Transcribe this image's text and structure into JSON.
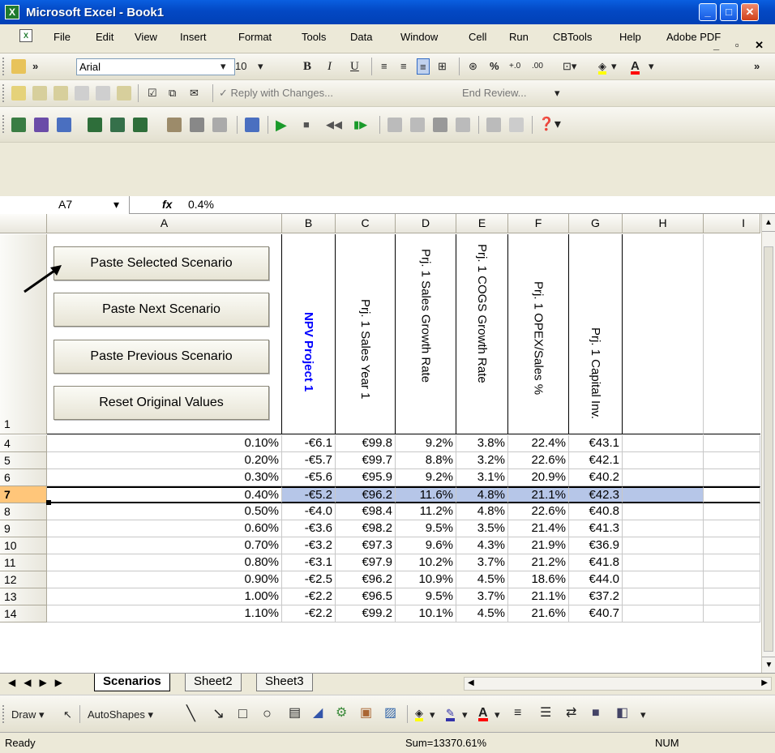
{
  "window": {
    "title": "Microsoft Excel - Book1",
    "app_icon": "excel-icon"
  },
  "menu": [
    "File",
    "Edit",
    "View",
    "Insert",
    "Format",
    "Tools",
    "Data",
    "Window",
    "Cell",
    "Run",
    "CBTools",
    "Help",
    "Adobe PDF"
  ],
  "toolbar": {
    "font": "Arial",
    "size": "10",
    "bold": "B",
    "italic": "I",
    "underline": "U",
    "percent": "%",
    "reply": "Reply with Changes...",
    "end_review": "End Review..."
  },
  "formula_bar": {
    "cell_ref": "A7",
    "fx": "fx",
    "value": "0.4%"
  },
  "columns": [
    "A",
    "B",
    "C",
    "D",
    "E",
    "F",
    "G",
    "H",
    "I"
  ],
  "buttons": [
    "Paste Selected Scenario",
    "Paste Next Scenario",
    "Paste Previous Scenario",
    "Reset Original Values"
  ],
  "headers": {
    "B": "NPV Project 1",
    "C": "Prj. 1 Sales Year 1",
    "D": "Prj. 1 Sales Growth Rate",
    "E": "Prj. 1 COGS Growth Rate",
    "F": "Prj. 1 OPEX/Sales %",
    "G": "Prj. 1 Capital Inv."
  },
  "header_row_num": "1",
  "rows": [
    {
      "n": "4",
      "a": "0.10%",
      "b": "-€6.1",
      "c": "€99.8",
      "d": "9.2%",
      "e": "3.8%",
      "f": "22.4%",
      "g": "€43.1"
    },
    {
      "n": "5",
      "a": "0.20%",
      "b": "-€5.7",
      "c": "€99.7",
      "d": "8.8%",
      "e": "3.2%",
      "f": "22.6%",
      "g": "€42.1"
    },
    {
      "n": "6",
      "a": "0.30%",
      "b": "-€5.6",
      "c": "€95.9",
      "d": "9.2%",
      "e": "3.1%",
      "f": "20.9%",
      "g": "€40.2"
    },
    {
      "n": "7",
      "a": "0.40%",
      "b": "-€5.2",
      "c": "€96.2",
      "d": "11.6%",
      "e": "4.8%",
      "f": "21.1%",
      "g": "€42.3"
    },
    {
      "n": "8",
      "a": "0.50%",
      "b": "-€4.0",
      "c": "€98.4",
      "d": "11.2%",
      "e": "4.8%",
      "f": "22.6%",
      "g": "€40.8"
    },
    {
      "n": "9",
      "a": "0.60%",
      "b": "-€3.6",
      "c": "€98.2",
      "d": "9.5%",
      "e": "3.5%",
      "f": "21.4%",
      "g": "€41.3"
    },
    {
      "n": "10",
      "a": "0.70%",
      "b": "-€3.2",
      "c": "€97.3",
      "d": "9.6%",
      "e": "4.3%",
      "f": "21.9%",
      "g": "€36.9"
    },
    {
      "n": "11",
      "a": "0.80%",
      "b": "-€3.1",
      "c": "€97.9",
      "d": "10.2%",
      "e": "3.7%",
      "f": "21.2%",
      "g": "€41.8"
    },
    {
      "n": "12",
      "a": "0.90%",
      "b": "-€2.5",
      "c": "€96.2",
      "d": "10.9%",
      "e": "4.5%",
      "f": "18.6%",
      "g": "€44.0"
    },
    {
      "n": "13",
      "a": "1.00%",
      "b": "-€2.2",
      "c": "€96.5",
      "d": "9.5%",
      "e": "3.7%",
      "f": "21.1%",
      "g": "€37.2"
    },
    {
      "n": "14",
      "a": "1.10%",
      "b": "-€2.2",
      "c": "€99.2",
      "d": "10.1%",
      "e": "4.5%",
      "f": "21.6%",
      "g": "€40.7"
    }
  ],
  "selected_row": "7",
  "tabs": [
    "Scenarios",
    "Sheet2",
    "Sheet3"
  ],
  "active_tab": "Scenarios",
  "drawbar": {
    "draw": "Draw",
    "autoshapes": "AutoShapes"
  },
  "status": {
    "left": "Ready",
    "sum": "Sum=13370.61%",
    "num": "NUM"
  },
  "colors": {
    "selection": "#b6c6e8",
    "npv_header": "#0000ff",
    "title_bar": "#0348c4"
  }
}
